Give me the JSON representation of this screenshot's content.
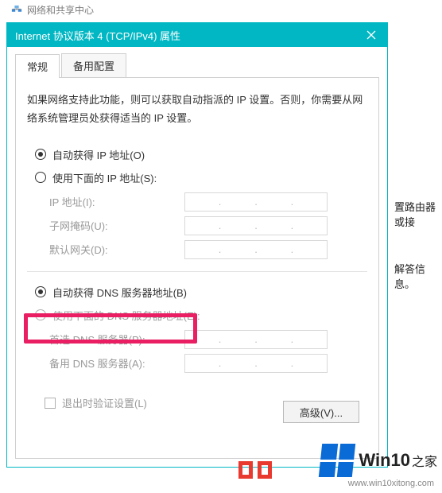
{
  "backwin": {
    "title": "网络和共享中心",
    "right_text_1": "置路由器或接",
    "right_text_2": "解答信息。"
  },
  "dialog": {
    "title": "Internet 协议版本 4 (TCP/IPv4) 属性",
    "tabs": {
      "general": "常规",
      "alternate": "备用配置"
    },
    "description": "如果网络支持此功能，则可以获取自动指派的 IP 设置。否则，你需要从网络系统管理员处获得适当的 IP 设置。",
    "ip": {
      "auto": "自动获得 IP 地址(O)",
      "manual": "使用下面的 IP 地址(S):",
      "addr_label": "IP 地址(I):",
      "mask_label": "子网掩码(U):",
      "gateway_label": "默认网关(D):"
    },
    "dns": {
      "auto": "自动获得 DNS 服务器地址(B)",
      "manual": "使用下面的 DNS 服务器地址(E):",
      "preferred_label": "首选 DNS 服务器(P):",
      "alternate_label": "备用 DNS 服务器(A):"
    },
    "validate_label": "退出时验证设置(L)",
    "advanced_label": "高级(V)..."
  },
  "watermark": {
    "brand1": "Win10",
    "brand2": "之家",
    "url": "www.win10xitong.com"
  }
}
